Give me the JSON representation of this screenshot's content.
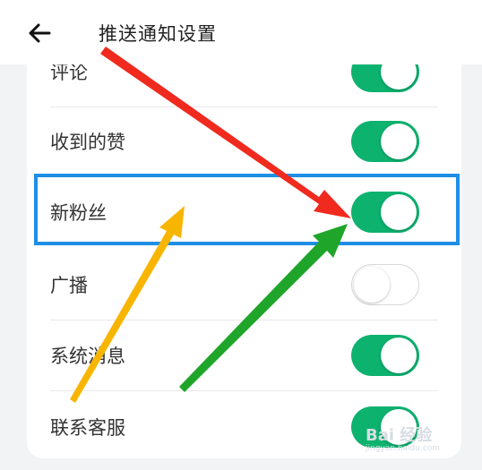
{
  "header": {
    "title": "推送通知设置",
    "back_icon": "arrow-left-icon"
  },
  "settings": [
    {
      "label": "评论",
      "enabled": true
    },
    {
      "label": "收到的赞",
      "enabled": true
    },
    {
      "label": "新粉丝",
      "enabled": true,
      "highlighted": true
    },
    {
      "label": "广播",
      "enabled": false
    },
    {
      "label": "系统消息",
      "enabled": true
    },
    {
      "label": "联系客服",
      "enabled": true
    }
  ],
  "colors": {
    "toggle_on": "#0db26f",
    "highlight_box": "#1d8fe6",
    "arrow_red": "#f02a1e",
    "arrow_yellow": "#f8b500",
    "arrow_green": "#1fa52a"
  },
  "watermark": {
    "text": "Bai 经验",
    "sub": "jingyan.baidu.com"
  }
}
